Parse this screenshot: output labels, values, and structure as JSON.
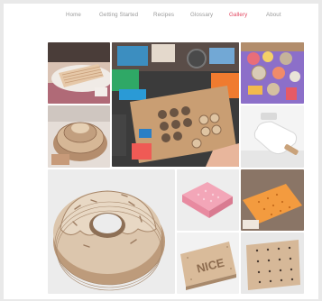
{
  "nav": {
    "items": [
      {
        "label": "Home"
      },
      {
        "label": "Getting Started"
      },
      {
        "label": "Recipes"
      },
      {
        "label": "Glossary"
      },
      {
        "label": "Gallery",
        "active": true
      },
      {
        "label": "About"
      }
    ],
    "active_color": "#e2445e",
    "color": "#9a9a9a"
  },
  "gallery": {
    "tiles": [
      {
        "name": "ribbed-cookie"
      },
      {
        "name": "craft-table"
      },
      {
        "name": "cookie-toys-purple"
      },
      {
        "name": "gear-cake"
      },
      {
        "name": "popsicle"
      },
      {
        "name": "donut-stack"
      },
      {
        "name": "pink-sponge"
      },
      {
        "name": "orange-cracker"
      },
      {
        "name": "nice-biscuit"
      },
      {
        "name": "cracker-plank"
      }
    ],
    "nice_text": "NICE"
  }
}
